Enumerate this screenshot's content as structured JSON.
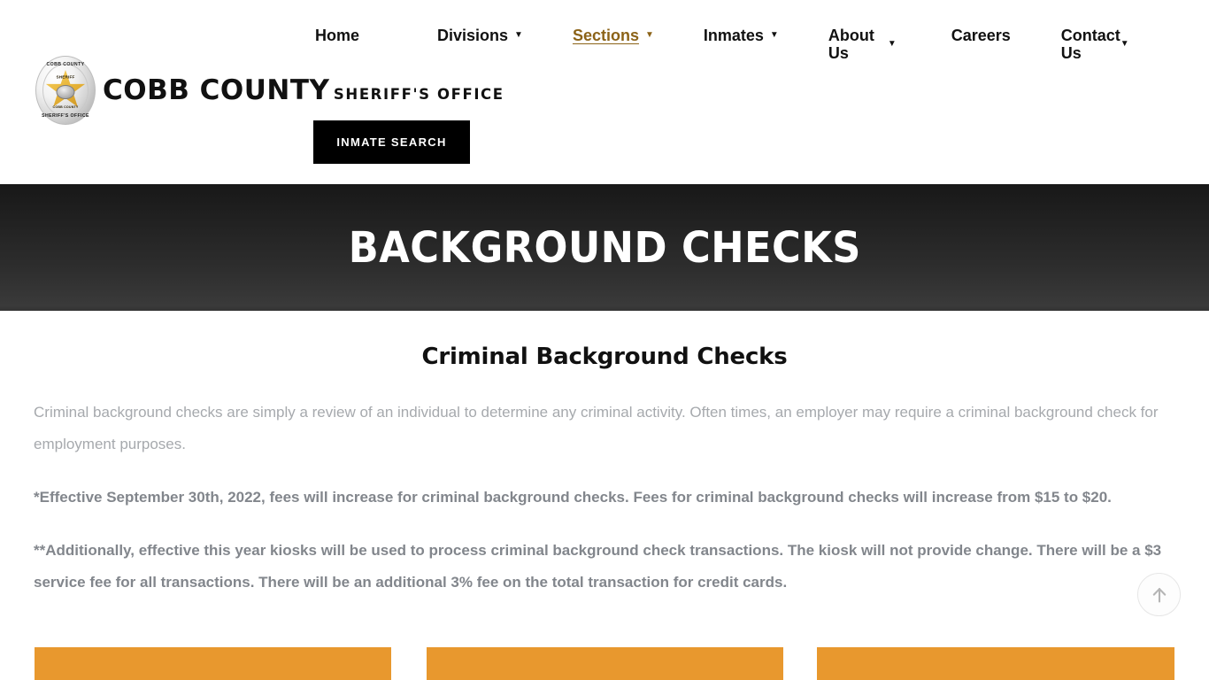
{
  "header": {
    "logo": {
      "badge_top_text": "COBB COUNTY",
      "badge_bottom_text": "SHERIFF'S OFFICE",
      "badge_star_label": "SHERIFF",
      "badge_star_sub": "COBB COUNTY",
      "line1": "COBB COUNTY",
      "line2": "SHERIFF'S OFFICE"
    },
    "nav": [
      {
        "label": "Home",
        "caret": "",
        "active": false
      },
      {
        "label": "Divisions",
        "caret": "▼",
        "active": false
      },
      {
        "label": "Sections",
        "caret": "▼",
        "active": true
      },
      {
        "label": "Inmates",
        "caret": "▼",
        "active": false
      },
      {
        "label": "About Us",
        "caret": "▼",
        "active": false
      },
      {
        "label": "Careers",
        "caret": "",
        "active": false
      },
      {
        "label": "Contact Us",
        "caret": "▼",
        "active": false
      }
    ],
    "inmate_search_label": "INMATE SEARCH"
  },
  "hero": {
    "title": "BACKGROUND CHECKS"
  },
  "main": {
    "heading": "Criminal Background Checks",
    "paragraph": "Criminal background checks are simply a review of an individual to determine any criminal activity. Often times, an employer may require a criminal background check for employment purposes.",
    "notice_1": "*Effective September 30th, 2022, fees will increase for criminal background checks. Fees for criminal background checks will increase from $15 to $20.",
    "notice_2": "**Additionally, effective this year kiosks will be used to process criminal background check transactions. The kiosk will not provide change. There will be a $3 service fee for all transactions. There will be an additional 3% fee on the total transaction for credit cards."
  },
  "cards": [
    {
      "label": ""
    },
    {
      "label": ""
    },
    {
      "label": ""
    }
  ],
  "scroll_top": {
    "icon": "arrow-up-icon"
  },
  "colors": {
    "accent_orange": "#e8982e",
    "active_link": "#8c6318",
    "logo_rule": "#d79a2b",
    "body_text": "#a6a9ad",
    "notice_text": "#82868c",
    "hero_dark": "#242424"
  }
}
